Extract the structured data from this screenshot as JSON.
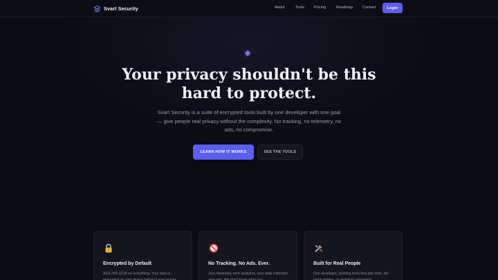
{
  "brand": {
    "name": "Svart Security",
    "icon": "layers-icon"
  },
  "nav": {
    "links": [
      "About",
      "Tools",
      "Pricing",
      "Roadmap",
      "Contact"
    ],
    "login_label": "Login"
  },
  "hero": {
    "title": "Your privacy shouldn't be this hard to protect.",
    "subtitle": "Svart Security is a suite of encrypted tools built by one developer with one goal — give people real privacy without the complexity. No tracking, no telemetry, no ads, no compromise.",
    "primary_cta": "LEARN HOW IT WORKS",
    "secondary_cta": "SEE THE TOOLS"
  },
  "features": [
    {
      "icon": "lock-icon",
      "title": "Encrypted by Default",
      "text": "AES-256-GCM on everything. Your data is encrypted on your device before it ever leaves."
    },
    {
      "icon": "no-entry-icon",
      "title": "No Tracking. No Ads. Ever.",
      "text": "Zero telemetry, zero analytics, zero data collection, zero ads. We don't know what you"
    },
    {
      "icon": "tools-icon",
      "title": "Built for Real People",
      "text": "One developer, building tools that just work. No setup guides, no terminal commands"
    }
  ],
  "colors": {
    "accent": "#5b5ef0",
    "background": "#0b0b12",
    "card": "#15151e"
  }
}
